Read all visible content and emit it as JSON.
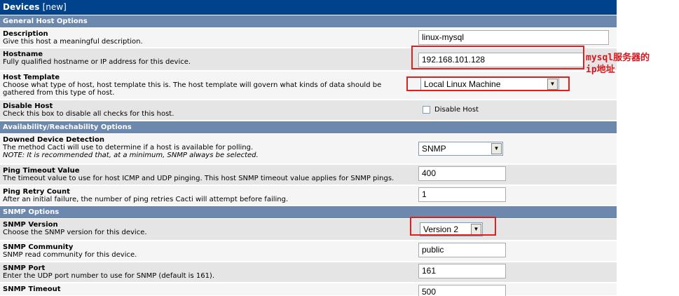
{
  "page": {
    "title": "Devices",
    "title_suffix": "[new]"
  },
  "sections": {
    "general": "General Host Options",
    "availability": "Availability/Reachability Options",
    "snmp": "SNMP Options"
  },
  "fields": {
    "description": {
      "label": "Description",
      "help": "Give this host a meaningful description.",
      "value": "linux-mysql"
    },
    "hostname": {
      "label": "Hostname",
      "help": "Fully qualified hostname or IP address for this device.",
      "value": "192.168.101.128"
    },
    "host_template": {
      "label": "Host Template",
      "help": "Choose what type of host, host template this is. The host template will govern what kinds of data should be gathered from this type of host.",
      "value": "Local Linux Machine"
    },
    "disable_host": {
      "label": "Disable Host",
      "help": "Check this box to disable all checks for this host.",
      "checkbox_label": "Disable Host"
    },
    "downed_detection": {
      "label": "Downed Device Detection",
      "help": "The method Cacti will use to determine if a host is available for polling.",
      "note": "NOTE: It is recommended that, at a minimum, SNMP always be selected.",
      "value": "SNMP"
    },
    "ping_timeout": {
      "label": "Ping Timeout Value",
      "help": "The timeout value to use for host ICMP and UDP pinging. This host SNMP timeout value applies for SNMP pings.",
      "value": "400"
    },
    "ping_retry": {
      "label": "Ping Retry Count",
      "help": "After an initial failure, the number of ping retries Cacti will attempt before failing.",
      "value": "1"
    },
    "snmp_version": {
      "label": "SNMP Version",
      "help": "Choose the SNMP version for this device.",
      "value": "Version 2"
    },
    "snmp_community": {
      "label": "SNMP Community",
      "help": "SNMP read community for this device.",
      "value": "public"
    },
    "snmp_port": {
      "label": "SNMP Port",
      "help": "Enter the UDP port number to use for SNMP (default is 161).",
      "value": "161"
    },
    "snmp_timeout": {
      "label": "SNMP Timeout",
      "value": "500"
    }
  },
  "annotation": {
    "line1": "mysql服务器的",
    "line2": "ip地址",
    "color": "#d4181e"
  },
  "colors": {
    "title_bar": "#00438c",
    "section_bar": "#6d88ad",
    "highlight": "#e0201e"
  }
}
